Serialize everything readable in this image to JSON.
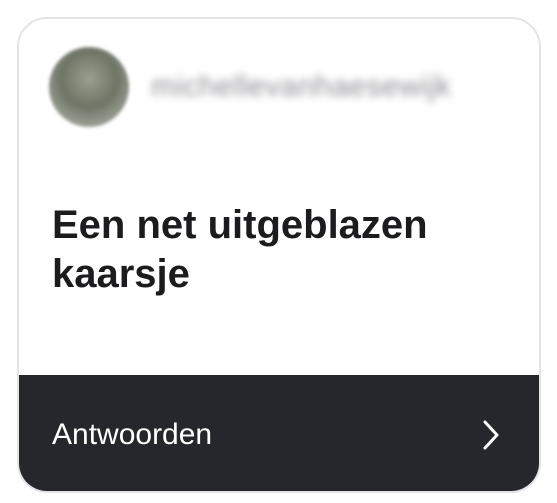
{
  "card": {
    "username": "michellevanhaesewijk",
    "message": "Een net uitgeblazen kaarsje",
    "reply_label": "Antwoorden"
  },
  "icons": {
    "avatar": "profile-photo",
    "chevron": "chevron-right-icon"
  },
  "colors": {
    "reply_bar": "#25272c",
    "text_dark": "#1c1c1e"
  }
}
